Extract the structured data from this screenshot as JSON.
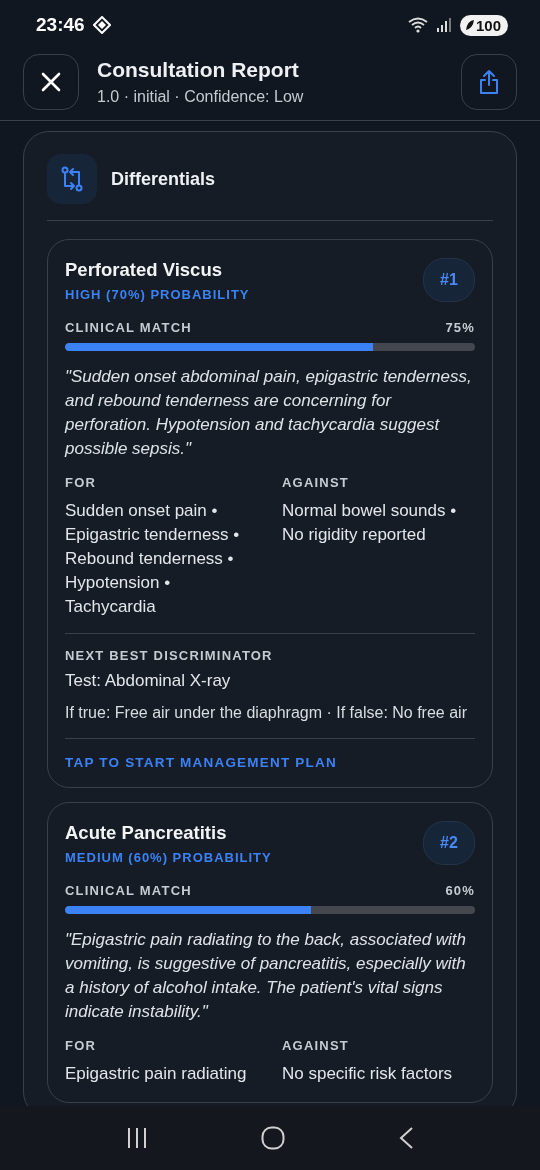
{
  "status_bar": {
    "time": "23:46",
    "battery": "100"
  },
  "header": {
    "title": "Consultation Report",
    "subtitle": "1.0 · initial · Confidence: Low"
  },
  "section": {
    "title": "Differentials"
  },
  "differentials": [
    {
      "name": "Perforated Viscus",
      "probability": "HIGH (70%) PROBABILITY",
      "rank": "#1",
      "match_label": "CLINICAL MATCH",
      "match_value": "75%",
      "level": 0.75,
      "rationale": "\"Sudden onset abdominal pain, epigastric tenderness, and rebound tenderness are concerning for perforation. Hypotension and tachycardia suggest possible sepsis.\"",
      "for_label": "FOR",
      "for_text": "Sudden onset pain • Epigastric tenderness • Rebound tenderness • Hypotension • Tachycardia",
      "against_label": "AGAINST",
      "against_text": "Normal bowel sounds • No rigidity reported",
      "discriminator": {
        "label": "NEXT BEST DISCRIMINATOR",
        "test": "Test: Abdominal X-ray",
        "outcome": "If true: Free air under the diaphragm · If false: No free air"
      },
      "action": "TAP TO START MANAGEMENT PLAN"
    },
    {
      "name": "Acute Pancreatitis",
      "probability": "MEDIUM (60%) PROBABILITY",
      "rank": "#2",
      "match_label": "CLINICAL MATCH",
      "match_value": "60%",
      "level": 0.6,
      "rationale": "\"Epigastric pain radiating to the back, associated with vomiting, is suggestive of pancreatitis, especially with a history of alcohol intake. The patient's vital signs indicate instability.\"",
      "for_label": "FOR",
      "for_text": "Epigastric pain radiating",
      "against_label": "AGAINST",
      "against_text": "No specific risk factors"
    }
  ]
}
